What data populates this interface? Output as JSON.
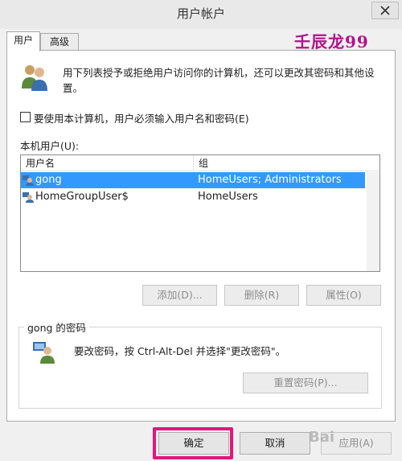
{
  "window": {
    "title": "用户帐户",
    "close_icon": "close-icon"
  },
  "tabs": [
    {
      "label": "用户",
      "active": true
    },
    {
      "label": "高级",
      "active": false
    }
  ],
  "watermark": "壬辰龙99",
  "intro": {
    "icon": "users-group-icon",
    "text": "用下列表授予或拒绝用户访问你的计算机，还可以更改其密码和其他设置。"
  },
  "require_password": {
    "checked": false,
    "label": "要使用本计算机，用户必须输入用户名和密码(E)"
  },
  "local_users": {
    "label": "本机用户(U):",
    "columns": [
      "用户名",
      "组"
    ],
    "rows": [
      {
        "name": "gong",
        "group": "HomeUsers; Administrators",
        "selected": true
      },
      {
        "name": "HomeGroupUser$",
        "group": "HomeUsers",
        "selected": false
      }
    ]
  },
  "user_buttons": {
    "add": "添加(D)...",
    "remove": "删除(R)",
    "properties": "属性(O)"
  },
  "password_group": {
    "title": "gong 的密码",
    "icon": "user-key-icon",
    "text": "要改密码，按 Ctrl-Alt-Del 并选择\"更改密码\"。",
    "reset_button": "重置密码(P)..."
  },
  "footer": {
    "ok": "确定",
    "cancel": "取消",
    "apply": "应用(A)"
  },
  "footer_watermark": "Bai",
  "colors": {
    "selection": "#3399ff",
    "highlight_box": "#e5157c",
    "watermark": "#b0138a"
  }
}
